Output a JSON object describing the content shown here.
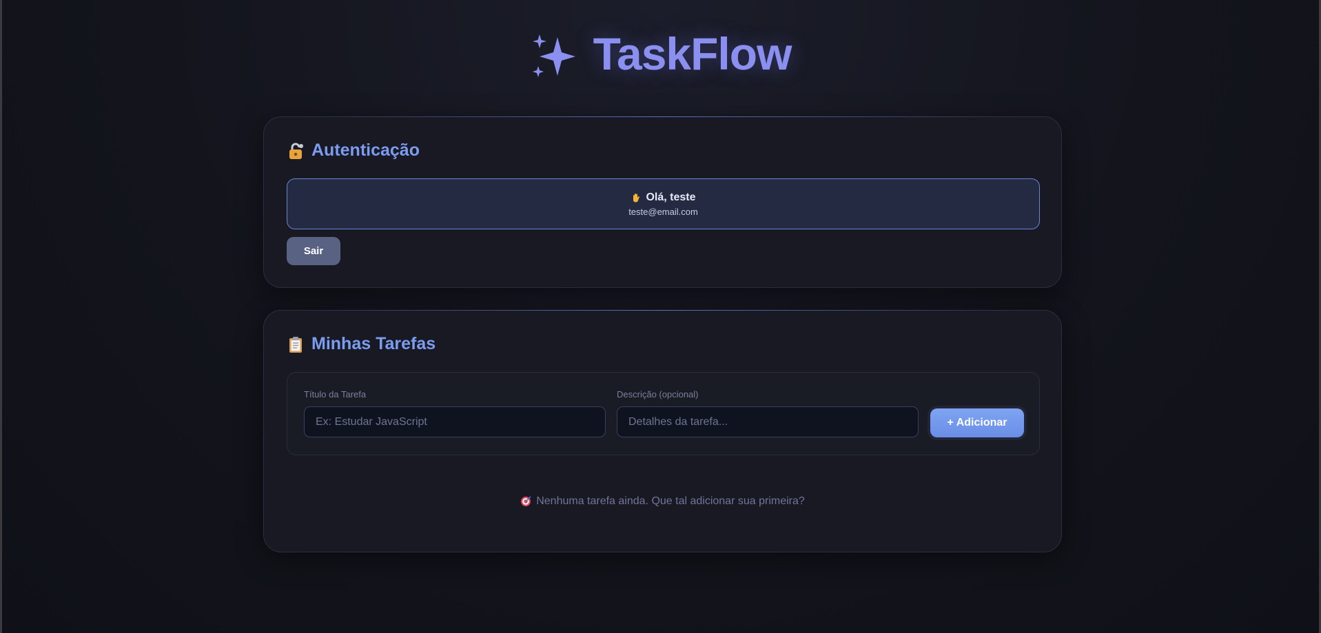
{
  "header": {
    "title": "TaskFlow",
    "icon": "sparkles-icon"
  },
  "auth": {
    "title": "Autenticação",
    "icon": "lock-icon",
    "greeting": "Olá, teste",
    "greeting_icon": "waving-hand-icon",
    "email": "teste@email.com",
    "logout_label": "Sair"
  },
  "tasks": {
    "title": "Minhas Tarefas",
    "icon": "clipboard-icon",
    "title_field": {
      "label": "Título da Tarefa",
      "value": "",
      "placeholder": "Ex: Estudar JavaScript"
    },
    "description_field": {
      "label": "Descrição (opcional)",
      "value": "",
      "placeholder": "Detalhes da tarefa..."
    },
    "add_label": "+ Adicionar",
    "empty_icon": "target-icon",
    "empty_text": "Nenhuma tarefa ainda. Que tal adicionar sua primeira?"
  },
  "colors": {
    "accent": "#7b9cf0",
    "brand": "#8b8ff0",
    "background": "#13141c",
    "card": "#181922"
  }
}
